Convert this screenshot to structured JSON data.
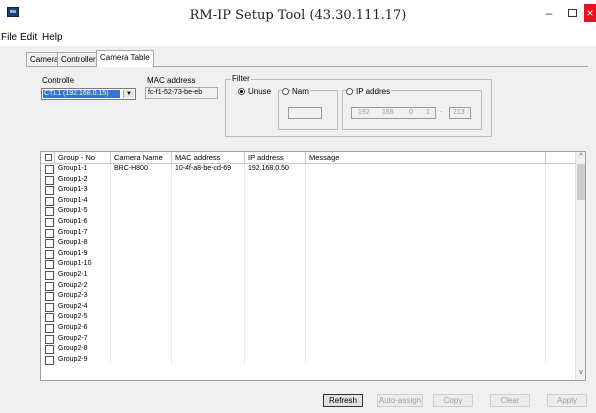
{
  "window": {
    "title": "RM-IP Setup Tool (43.30.111.17)",
    "minimize": "–",
    "close": "×"
  },
  "menu": [
    "File",
    "Edit",
    "Help"
  ],
  "tabs": [
    "Camera",
    "Controller",
    "Camera Table"
  ],
  "controller": {
    "label": "Controlle",
    "value": "CTL1 (192.168.0.15)",
    "arrow": "▼"
  },
  "mac": {
    "label": "MAC address",
    "value": "fc-f1-52-73-be-eb"
  },
  "filter": {
    "label": "Filter",
    "unused_label": "Unuse",
    "name_label": "Nam",
    "ip_label": "IP addres",
    "ip_octets": [
      "192",
      "168",
      "0",
      "1"
    ],
    "ip_dash": "-",
    "ip_end": "213"
  },
  "table": {
    "columns": [
      "Group - No",
      "Camera Name",
      "MAC address",
      "IP address",
      "Message"
    ],
    "rows": [
      {
        "group": "Group1-1",
        "camera": "BRC-H800",
        "mac": "10-4f-a8-be-cd-69",
        "ip": "192.168.0.50",
        "msg": ""
      },
      {
        "group": "Group1-2",
        "camera": "",
        "mac": "",
        "ip": "",
        "msg": ""
      },
      {
        "group": "Group1-3",
        "camera": "",
        "mac": "",
        "ip": "",
        "msg": ""
      },
      {
        "group": "Group1-4",
        "camera": "",
        "mac": "",
        "ip": "",
        "msg": ""
      },
      {
        "group": "Group1-5",
        "camera": "",
        "mac": "",
        "ip": "",
        "msg": ""
      },
      {
        "group": "Group1-6",
        "camera": "",
        "mac": "",
        "ip": "",
        "msg": ""
      },
      {
        "group": "Group1-7",
        "camera": "",
        "mac": "",
        "ip": "",
        "msg": ""
      },
      {
        "group": "Group1-8",
        "camera": "",
        "mac": "",
        "ip": "",
        "msg": ""
      },
      {
        "group": "Group1-9",
        "camera": "",
        "mac": "",
        "ip": "",
        "msg": ""
      },
      {
        "group": "Group1-10",
        "camera": "",
        "mac": "",
        "ip": "",
        "msg": ""
      },
      {
        "group": "Group2-1",
        "camera": "",
        "mac": "",
        "ip": "",
        "msg": ""
      },
      {
        "group": "Group2-2",
        "camera": "",
        "mac": "",
        "ip": "",
        "msg": ""
      },
      {
        "group": "Group2-3",
        "camera": "",
        "mac": "",
        "ip": "",
        "msg": ""
      },
      {
        "group": "Group2-4",
        "camera": "",
        "mac": "",
        "ip": "",
        "msg": ""
      },
      {
        "group": "Group2-5",
        "camera": "",
        "mac": "",
        "ip": "",
        "msg": ""
      },
      {
        "group": "Group2-6",
        "camera": "",
        "mac": "",
        "ip": "",
        "msg": ""
      },
      {
        "group": "Group2-7",
        "camera": "",
        "mac": "",
        "ip": "",
        "msg": ""
      },
      {
        "group": "Group2-8",
        "camera": "",
        "mac": "",
        "ip": "",
        "msg": ""
      },
      {
        "group": "Group2-9",
        "camera": "",
        "mac": "",
        "ip": "",
        "msg": ""
      }
    ]
  },
  "scroll": {
    "up": "^",
    "down": "v"
  },
  "buttons": {
    "refresh": "Refresh",
    "auto_assign": "Auto-assign",
    "copy": "Copy",
    "clear": "Clear",
    "apply": "Apply"
  }
}
